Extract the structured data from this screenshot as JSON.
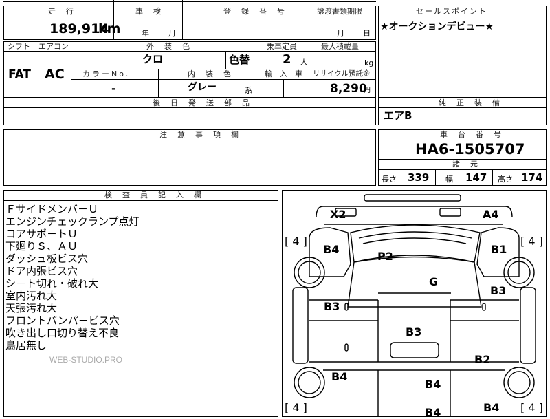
{
  "top": {
    "mileage_header": "走　行",
    "inspection_header": "車　検",
    "registration_header": "登　録　番　号",
    "transfer_header": "譲渡書類期限",
    "sales_point_header": "セールスポイント",
    "mileage_value": "189,914",
    "mileage_unit": "km",
    "inspection_year": "年",
    "inspection_month": "月",
    "transfer_month": "月",
    "transfer_day": "日",
    "sales_point_text": "★オークションデビュー★"
  },
  "mid": {
    "shift_header": "シフト",
    "ac_header": "エアコン",
    "exterior_color_header": "外　装　色",
    "capacity_header": "乗車定員",
    "max_load_header": "最大積載量",
    "shift_value": "FAT",
    "ac_value": "AC",
    "exterior_color_value": "クロ",
    "color_change": "色替",
    "capacity_value": "2",
    "capacity_unit": "人",
    "max_load_unit": "kg",
    "color_no_header": "カラーNo.",
    "interior_color_header": "内　装　色",
    "import_header": "輸　入　車",
    "recycle_header": "リサイクル預託金",
    "color_no_value": "-",
    "interior_color_value": "グレー",
    "interior_color_suffix": "系",
    "recycle_value": "8,290",
    "recycle_unit": "円",
    "later_parts_header": "後　日　発　送　部　品",
    "genuine_equipment_header": "純　正　装　備",
    "genuine_equipment_value": "エアB"
  },
  "notes": {
    "header": "注　意　事　項　欄"
  },
  "chassis": {
    "header": "車　台　番　号",
    "value": "HA6-1505707",
    "specs_header": "諸　元",
    "length_label": "長さ",
    "length_value": "339",
    "width_label": "幅",
    "width_value": "147",
    "height_label": "高さ",
    "height_value": "174"
  },
  "inspector": {
    "header": "検　査　員　記　入　欄",
    "lines": [
      "Ｆサイドメンバ－Ｕ",
      "エンジンチェックランプ点灯",
      "コアサポ－トＵ",
      "下廻りＳ、ＡＵ",
      "ダッシュ板ビス穴",
      "ドア内張ビス穴",
      "シ－ト切れ・破れ大",
      "室内汚れ大",
      "天張汚れ大",
      "フロントバンパ－ビス穴",
      "吹き出し口切り替え不良",
      "鳥居無し"
    ],
    "watermark": "WEB-STUDIO.PRO"
  },
  "diagram": {
    "tire_labels": [
      "[ 4 ]",
      "[ 4 ]",
      "[ 4 ]",
      "[ 4 ]"
    ],
    "marks": [
      "X2",
      "A4",
      "B4",
      "P2",
      "B1",
      "G",
      "B3",
      "B3",
      "B3",
      "B4",
      "B4",
      "B2",
      "B4",
      "B4"
    ]
  }
}
